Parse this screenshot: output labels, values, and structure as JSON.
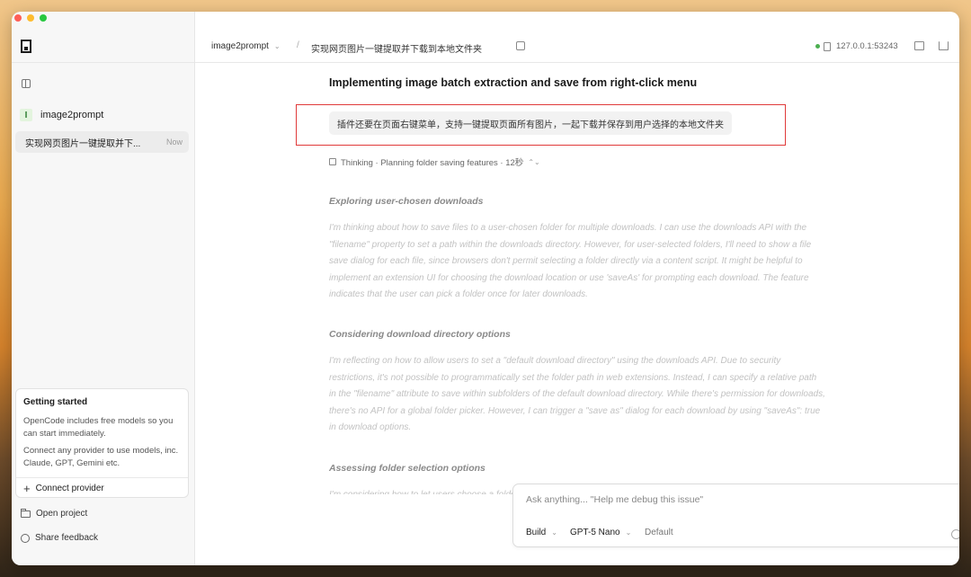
{
  "window": {
    "traffic_colors": [
      "#fe5f57",
      "#febc2e",
      "#28c840"
    ]
  },
  "sidebar": {
    "project_badge": "I",
    "project_name": "image2prompt",
    "session": {
      "title": "实现网页图片一键提取并下...",
      "time": "Now"
    },
    "getting_started": {
      "title": "Getting started",
      "p1": "OpenCode includes free models so you can start immediately.",
      "p2": "Connect any provider to use models, inc. Claude, GPT, Gemini etc.",
      "action_label": "Connect provider"
    },
    "open_project": "Open project",
    "share_feedback": "Share feedback"
  },
  "topbar": {
    "project": "image2prompt",
    "separator": "/",
    "session_title": "实现网页图片一键提取并下载到本地文件夹",
    "server": "127.0.0.1:53243",
    "server_status_color": "#4caf50"
  },
  "conversation": {
    "heading": "Implementing image batch extraction and save from right-click menu",
    "user_message": "插件还要在页面右键菜单，支持一键提取页面所有图片，一起下载并保存到用户选择的本地文件夹",
    "thinking": "Thinking · Planning folder saving features · 12秒",
    "sections": [
      {
        "title": "Exploring user-chosen downloads",
        "body": "I'm thinking about how to save files to a user-chosen folder for multiple downloads. I can use the downloads API with the \"filename\" property to set a path within the downloads directory. However, for user-selected folders, I'll need to show a file save dialog for each file, since browsers don't permit selecting a folder directly via a content script. It might be helpful to implement an extension UI for choosing the download location or use 'saveAs' for prompting each download. The feature indicates that the user can pick a folder once for later downloads."
      },
      {
        "title": "Considering download directory options",
        "body": "I'm reflecting on how to allow users to set a \"default download directory\" using the downloads API. Due to security restrictions, it's not possible to programmatically set the folder path in web extensions. Instead, I can specify a relative path in the \"filename\" attribute to save within subfolders of the default download directory. While there's permission for downloads, there's no API for a global folder picker. However, I can trigger a \"save as\" dialog for each download by using \"saveAs\": true in download options."
      },
      {
        "title": "Assessing folder selection options",
        "body": "I'm considering how to let users choose a folder for downloads without setting a single default for everything."
      }
    ],
    "highlight_color": "#e03a3a"
  },
  "composer": {
    "placeholder": "Ask anything... \"Help me debug this issue\"",
    "mode": "Build",
    "model": "GPT-5 Nano",
    "variant": "Default"
  }
}
